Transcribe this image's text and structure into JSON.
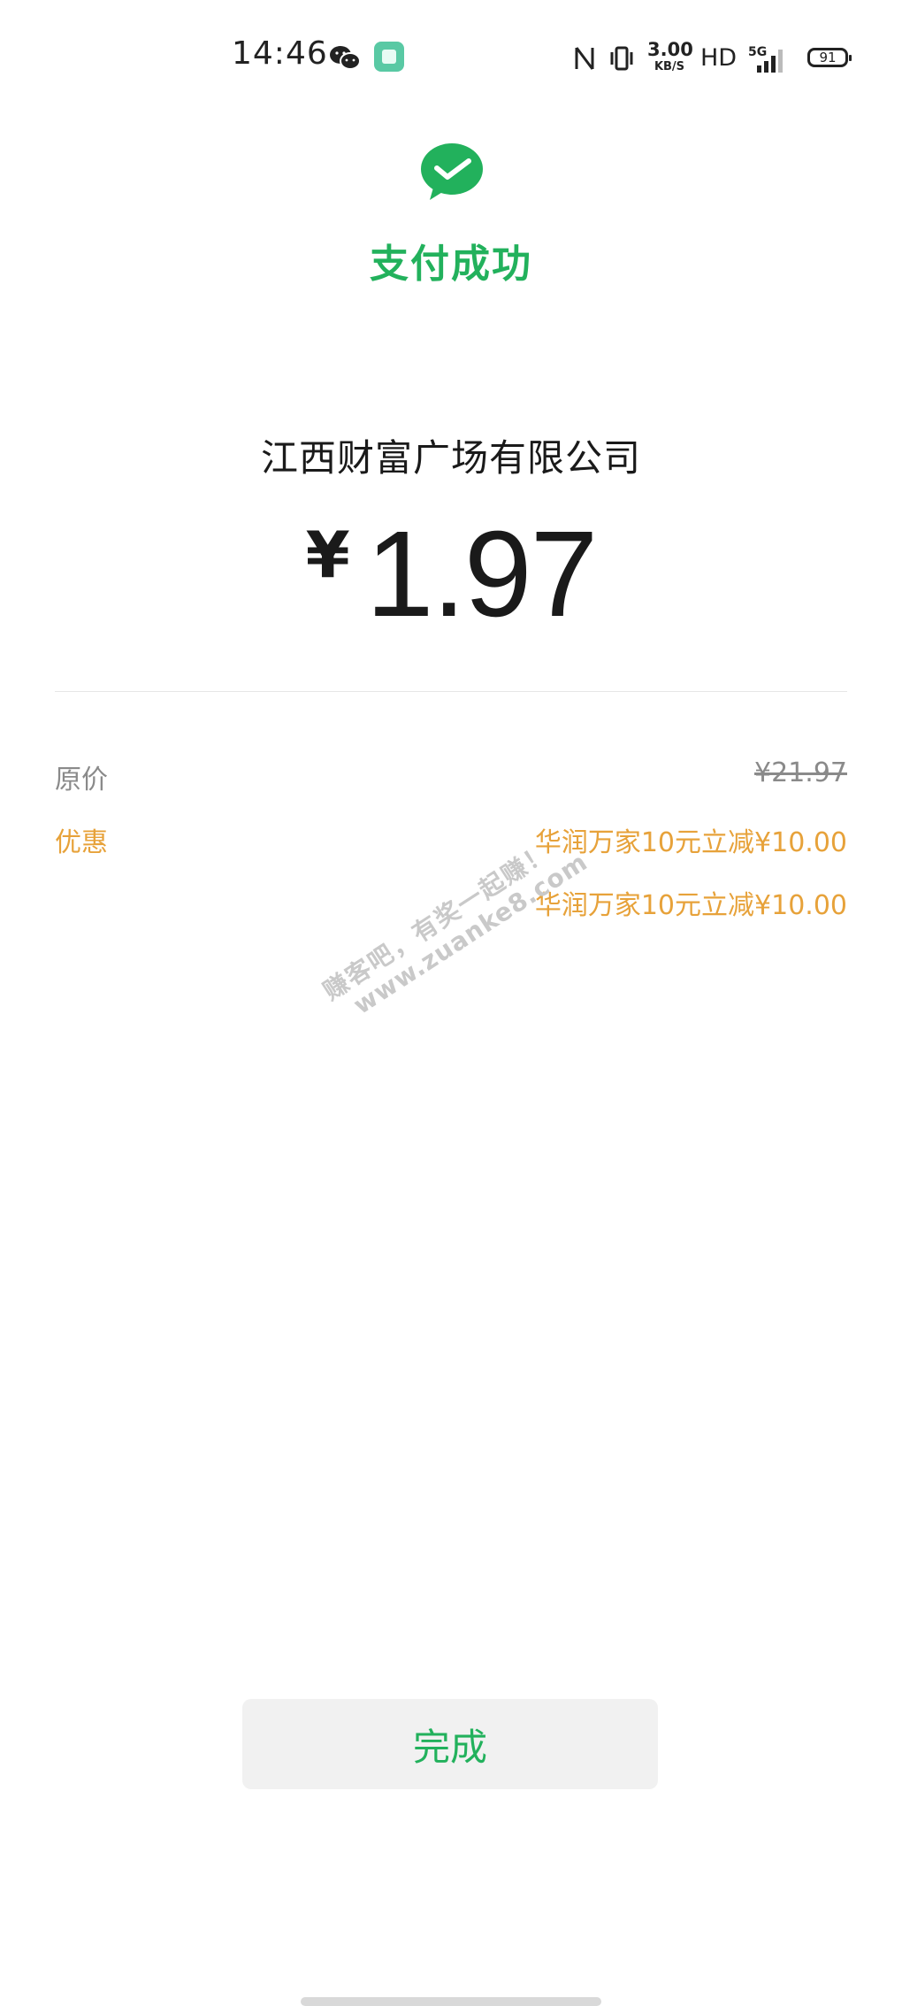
{
  "status_bar": {
    "time": "14:46",
    "net_speed_value": "3.00",
    "net_speed_unit": "KB/S",
    "hd_label": "HD",
    "network_label": "5G",
    "battery_level": "91",
    "icons": [
      "wechat-icon",
      "app-icon",
      "nfc-icon",
      "vibrate-icon",
      "signal-icon",
      "battery-icon"
    ]
  },
  "payment": {
    "status_title": "支付成功",
    "merchant_name": "江西财富广场有限公司",
    "currency_symbol": "¥",
    "amount": "1.97"
  },
  "details": {
    "original_price_label": "原价",
    "original_price_value": "¥21.97",
    "discount_label": "优惠",
    "discounts": [
      "华润万家10元立减¥10.00",
      "华润万家10元立减¥10.00"
    ]
  },
  "watermark": {
    "line1": "赚客吧，有奖一起赚！",
    "line2": "www.zuanke8.com"
  },
  "actions": {
    "done_label": "完成"
  },
  "colors": {
    "brand_green": "#22b15c",
    "discount_orange": "#e7a23a",
    "muted_gray": "#8a8a8a"
  }
}
